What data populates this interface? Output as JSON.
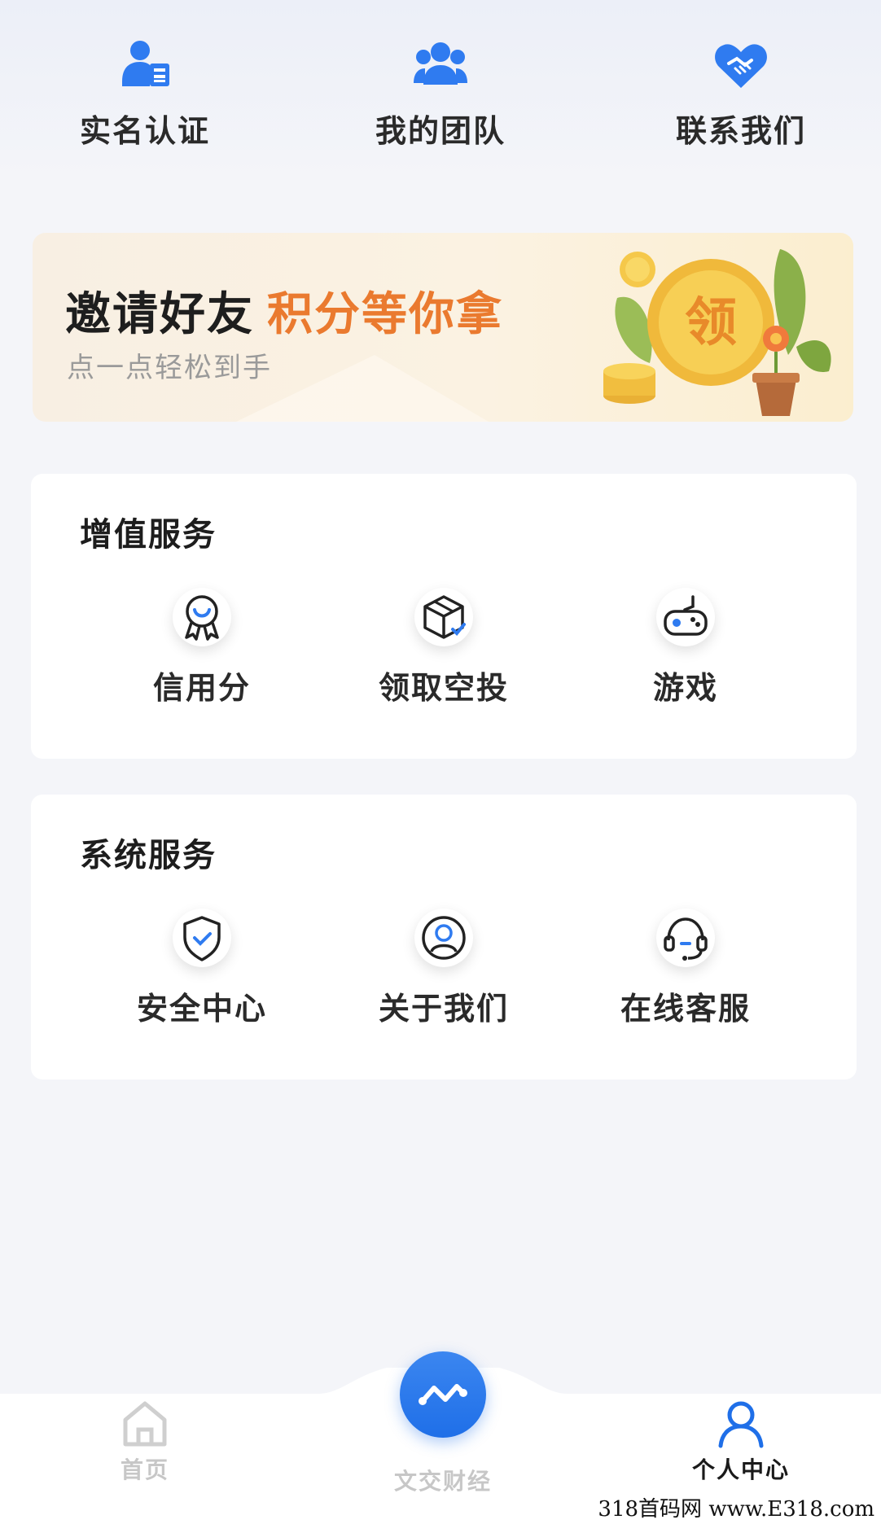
{
  "quick_actions": [
    {
      "label": "实名认证",
      "icon": "id-card-icon"
    },
    {
      "label": "我的团队",
      "icon": "team-icon"
    },
    {
      "label": "联系我们",
      "icon": "handshake-heart-icon"
    }
  ],
  "banner": {
    "title": "邀请好友",
    "title_accent": "积分等你拿",
    "subtitle": "点一点轻松到手",
    "art_text": "领",
    "accent_color": "#ea7a2f"
  },
  "value_services": {
    "title": "增值服务",
    "items": [
      {
        "label": "信用分",
        "icon": "badge-icon"
      },
      {
        "label": "领取空投",
        "icon": "box-icon"
      },
      {
        "label": "游戏",
        "icon": "gamepad-icon"
      }
    ]
  },
  "system_services": {
    "title": "系统服务",
    "items": [
      {
        "label": "安全中心",
        "icon": "shield-icon"
      },
      {
        "label": "关于我们",
        "icon": "user-circle-icon"
      },
      {
        "label": "在线客服",
        "icon": "headset-icon"
      }
    ]
  },
  "bottom_nav": {
    "items": [
      {
        "label": "首页",
        "icon": "home-icon",
        "active": false
      },
      {
        "label": "文交财经",
        "icon": "trend-icon",
        "active": false
      },
      {
        "label": "个人中心",
        "icon": "person-icon",
        "active": true
      }
    ],
    "accent_color": "#1f6fe8"
  },
  "watermark": "318首码网 www.E318.com"
}
